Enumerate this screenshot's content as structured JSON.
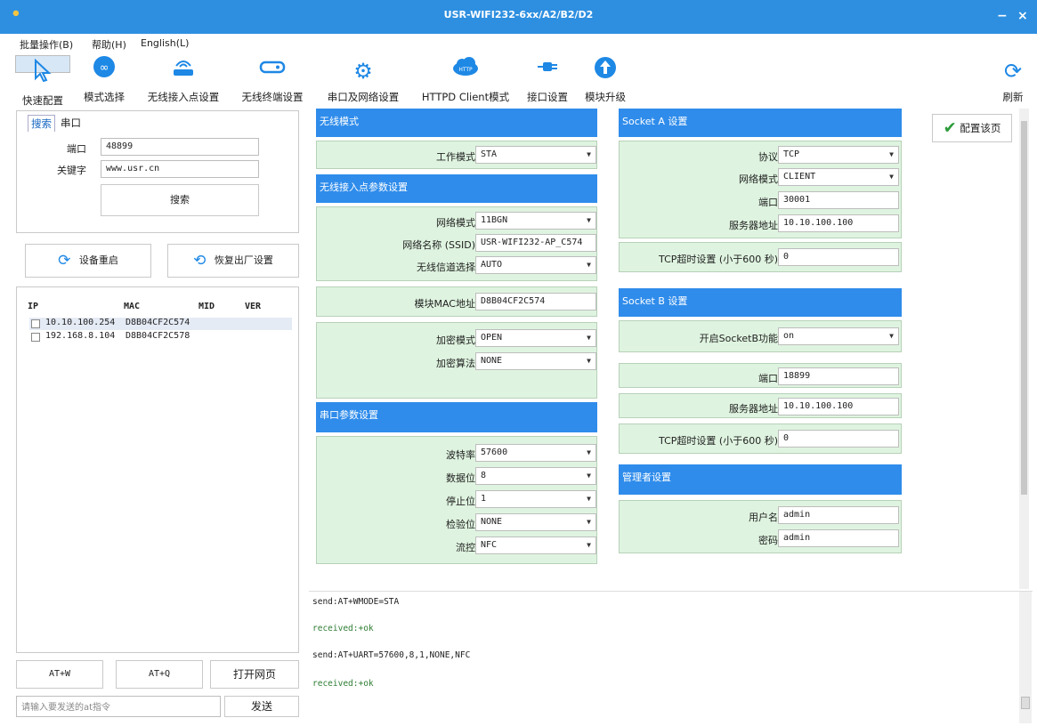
{
  "window": {
    "title": "USR-WIFI232-6xx/A2/B2/D2",
    "minimize": "−",
    "close": "×"
  },
  "menu": [
    "批量操作(B)",
    "帮助(H)",
    "English(L)"
  ],
  "toolbar": {
    "items": [
      {
        "label": "快速配置",
        "icon": "cursor-icon"
      },
      {
        "label": "模式选择",
        "icon": "mode-icon"
      },
      {
        "label": "无线接入点设置",
        "icon": "router-icon"
      },
      {
        "label": "无线终端设置",
        "icon": "terminal-icon"
      },
      {
        "label": "串口及网络设置",
        "icon": "gear-icon"
      },
      {
        "label": "HTTPD Client模式",
        "icon": "http-cloud-icon"
      },
      {
        "label": "接口设置",
        "icon": "plug-icon"
      },
      {
        "label": "模块升级",
        "icon": "upgrade-icon"
      }
    ],
    "refresh": "刷新"
  },
  "left": {
    "tabs": [
      "搜索",
      "串口"
    ],
    "port_label": "端口",
    "port_value": "48899",
    "keyword_label": "关键字",
    "keyword_value": "www.usr.cn",
    "search_btn": "搜索",
    "restart_btn": "设备重启",
    "factory_btn": "恢复出厂设置",
    "dev_headers": {
      "ip": "IP",
      "mac": "MAC",
      "mid": "MID",
      "ver": "VER"
    },
    "devices": [
      {
        "ip": "10.10.100.254",
        "mac": "D8B04CF2C574"
      },
      {
        "ip": "192.168.8.104",
        "mac": "D8B04CF2C578"
      }
    ],
    "atw": "AT+W",
    "atq": "AT+Q",
    "open_web": "打开网页",
    "cmd_placeholder": "请输入要发送的at指令",
    "send": "发送"
  },
  "wireless_mode": {
    "title": "无线模式",
    "work_mode_label": "工作模式",
    "work_mode": "STA"
  },
  "ap_params": {
    "title": "无线接入点参数设置",
    "net_mode_label": "网络模式",
    "net_mode": "11BGN",
    "ssid_label": "网络名称 (SSID)",
    "ssid": "USR-WIFI232-AP_C574",
    "channel_label": "无线信道选择",
    "channel": "AUTO",
    "mac_label": "模块MAC地址",
    "mac": "D8B04CF2C574",
    "enc_mode_label": "加密模式",
    "enc_mode": "OPEN",
    "enc_algo_label": "加密算法",
    "enc_algo": "NONE"
  },
  "uart": {
    "title": "串口参数设置",
    "baud_label": "波特率",
    "baud": "57600",
    "data_label": "数据位",
    "data": "8",
    "stop_label": "停止位",
    "stop": "1",
    "parity_label": "检验位",
    "parity": "NONE",
    "flow_label": "流控",
    "flow": "NFC"
  },
  "socket_a": {
    "title": "Socket A 设置",
    "proto_label": "协议",
    "proto": "TCP",
    "netmode_label": "网络模式",
    "netmode": "CLIENT",
    "port_label": "端口",
    "port": "30001",
    "server_label": "服务器地址",
    "server": "10.10.100.100",
    "timeout_label": "TCP超时设置 (小于600 秒)",
    "timeout": "0"
  },
  "socket_b": {
    "title": "Socket B 设置",
    "enable_label": "开启SocketB功能",
    "enable": "on",
    "port_label": "端口",
    "port": "18899",
    "server_label": "服务器地址",
    "server": "10.10.100.100",
    "timeout_label": "TCP超时设置 (小于600 秒)",
    "timeout": "0"
  },
  "admin": {
    "title": "管理者设置",
    "user_label": "用户名",
    "user": "admin",
    "pwd_label": "密码",
    "pwd": "admin"
  },
  "config_btn": "配置该页",
  "log": [
    "send:AT+WMODE=STA",
    "received:+ok",
    "send:AT+UART=57600,8,1,NONE,NFC",
    "received:+ok"
  ],
  "colors": {
    "title_bar": "#2e8fe0",
    "section": "#2f8ceb",
    "group_bg": "#dff4e0",
    "received": "#2e7d32"
  }
}
